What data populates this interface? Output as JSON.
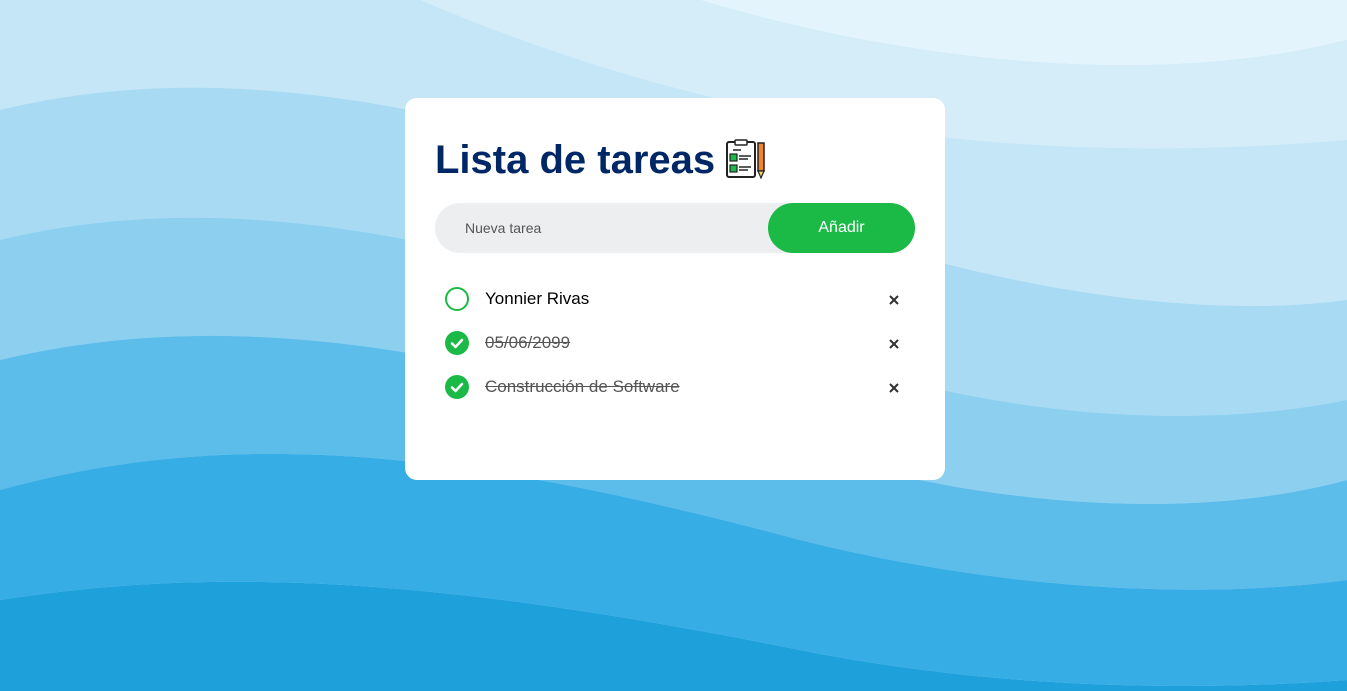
{
  "colors": {
    "title": "#002765",
    "accent": "#1bb946",
    "input_bg": "#edeef0",
    "card_bg": "#ffffff"
  },
  "header": {
    "title": "Lista de tareas",
    "icon": "checklist-notepad-icon"
  },
  "add_task": {
    "placeholder": "Nueva tarea",
    "value": "",
    "button_label": "Añadir"
  },
  "tasks": [
    {
      "text": "Yonnier Rivas",
      "completed": false
    },
    {
      "text": "05/06/2099",
      "completed": true
    },
    {
      "text": "Construcción de Software",
      "completed": true
    }
  ],
  "icons": {
    "unchecked": "circle-icon",
    "checked": "check-circle-icon",
    "delete": "close-icon"
  }
}
